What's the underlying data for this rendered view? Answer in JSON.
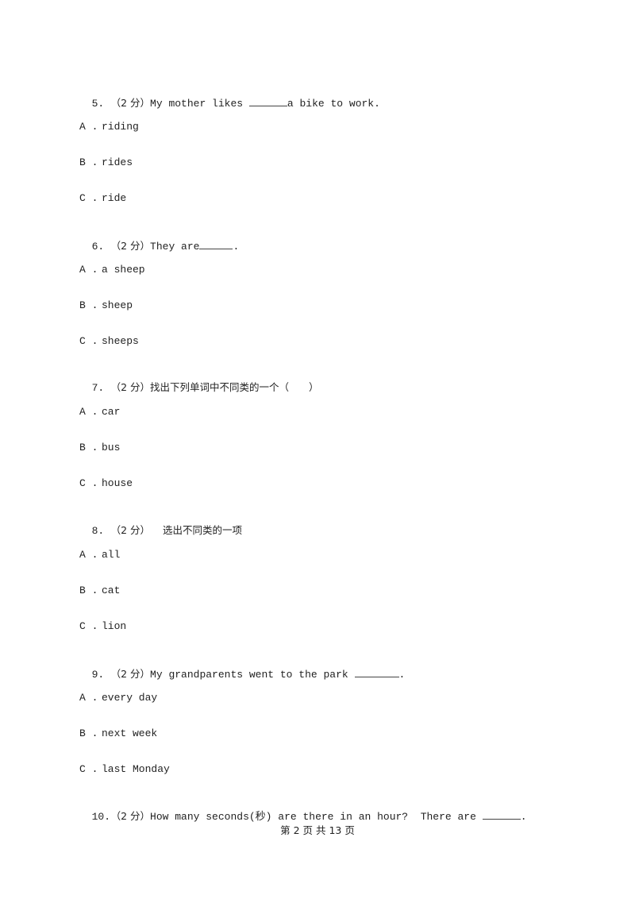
{
  "questions": [
    {
      "number": "5.",
      "score": "（2 分）",
      "text_before": "My mother likes ",
      "blank": "_______",
      "text_after": "a bike to work.",
      "options": [
        {
          "letter": "A .",
          "text": "riding"
        },
        {
          "letter": "B .",
          "text": "rides"
        },
        {
          "letter": "C .",
          "text": "ride"
        }
      ]
    },
    {
      "number": "6.",
      "score": "（2 分）",
      "text_before": "They are",
      "blank": "______",
      "text_after": ".",
      "options": [
        {
          "letter": "A .",
          "text": "a sheep"
        },
        {
          "letter": "B .",
          "text": "sheep"
        },
        {
          "letter": "C .",
          "text": "sheeps"
        }
      ]
    },
    {
      "number": "7.",
      "score": "（2 分）",
      "text_before": "找出下列单词中不同类的一个（　　）",
      "blank": "",
      "text_after": "",
      "options": [
        {
          "letter": "A .",
          "text": "car"
        },
        {
          "letter": "B .",
          "text": "bus"
        },
        {
          "letter": "C .",
          "text": "house"
        }
      ]
    },
    {
      "number": "8.",
      "score": "（2 分）",
      "text_before": "    选出不同类的一项",
      "blank": "",
      "text_after": "",
      "options": [
        {
          "letter": "A .",
          "text": "all"
        },
        {
          "letter": "B .",
          "text": "cat"
        },
        {
          "letter": "C .",
          "text": "lion"
        }
      ]
    },
    {
      "number": "9.",
      "score": "（2 分）",
      "text_before": "My grandparents went to the park ",
      "blank": "________",
      "text_after": ".",
      "options": [
        {
          "letter": "A .",
          "text": "every day"
        },
        {
          "letter": "B .",
          "text": "next week"
        },
        {
          "letter": "C .",
          "text": "last Monday"
        }
      ]
    },
    {
      "number": "10.",
      "score": "（2 分）",
      "text_before": "How many seconds(秒) are there in an hour?  There are ",
      "blank": "_______",
      "text_after": ".",
      "options": []
    }
  ],
  "footer": {
    "page_label": "第 2 页 共 13 页"
  }
}
